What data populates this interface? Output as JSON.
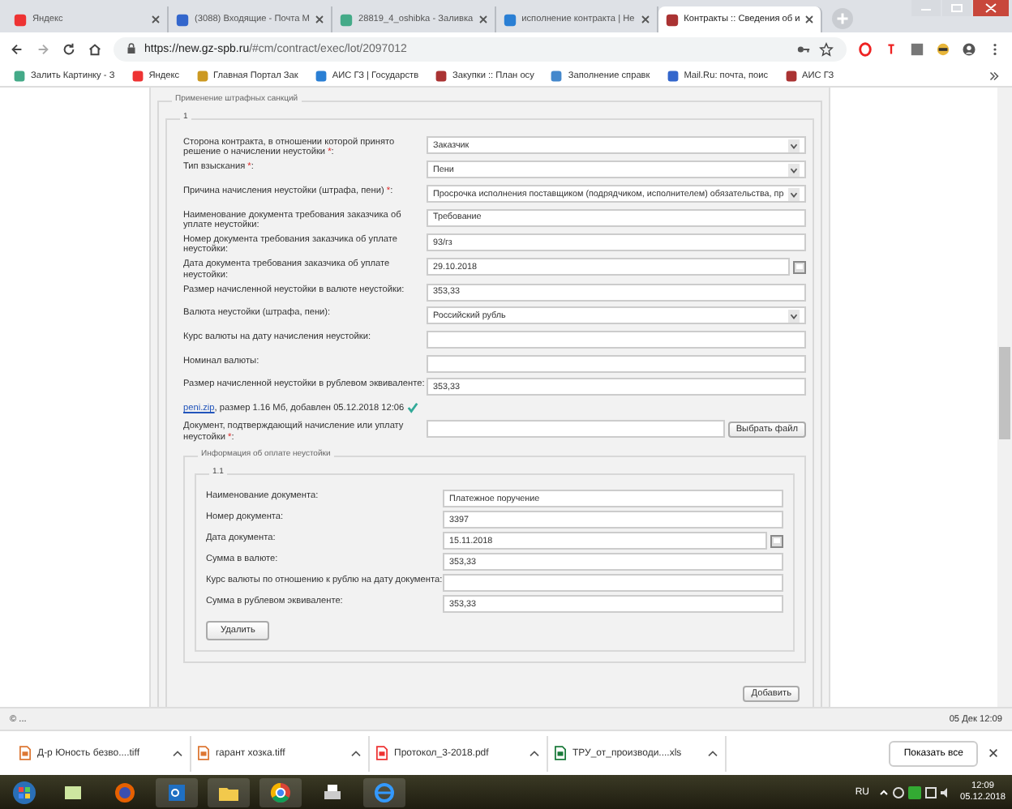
{
  "browser": {
    "tabs": [
      {
        "title": "Яндекс",
        "selected": false
      },
      {
        "title": "(3088) Входящие - Почта М",
        "selected": false
      },
      {
        "title": "28819_4_oshibka - Заливка",
        "selected": false
      },
      {
        "title": "исполнение контракта | Не",
        "selected": false
      },
      {
        "title": "Контракты :: Сведения об и",
        "selected": true
      }
    ],
    "url_host": "https://new.gz-spb.ru",
    "url_path": "/#cm/contract/exec/lot/2097012",
    "bookmarks": [
      {
        "title": "Залить Картинку - З"
      },
      {
        "title": "Яндекс"
      },
      {
        "title": "Главная Портал Зак"
      },
      {
        "title": "АИС ГЗ | Государств"
      },
      {
        "title": "Закупки :: План осу"
      },
      {
        "title": "Заполнение справк"
      },
      {
        "title": "Mail.Ru: почта, поис"
      },
      {
        "title": "АИС ГЗ"
      }
    ]
  },
  "form": {
    "legend": "Применение штрафных санкций",
    "group": "1",
    "fields": [
      {
        "kind": "select",
        "label": "Сторона контракта, в отношении которой принято решение о начислении неустойки ",
        "mark": "*",
        "label_end": ":",
        "value": "Заказчик"
      },
      {
        "kind": "select",
        "label": "Тип взыскания ",
        "mark": "*",
        "label_end": ":",
        "value": "Пени"
      },
      {
        "kind": "select",
        "label": "Причина начисления неустойки (штрафа, пени) ",
        "mark": "*",
        "label_end": ":",
        "value": "Просрочка исполнения поставщиком (подрядчиком, исполнителем) обязательства, пр"
      },
      {
        "kind": "text",
        "label": "Наименование документа требования заказчика об уплате неустойки:",
        "value": "Требование"
      },
      {
        "kind": "text",
        "label": "Номер документа требования заказчика об уплате неустойки:",
        "value": "93/гз"
      },
      {
        "kind": "date",
        "label": "Дата документа требования заказчика об уплате неустойки:",
        "value": "29.10.2018"
      },
      {
        "kind": "text",
        "label": "Размер начисленной неустойки в валюте неустойки:",
        "value": "353,33"
      },
      {
        "kind": "select",
        "label": "Валюта неустойки (штрафа, пени):",
        "value": "Российский рубль"
      },
      {
        "kind": "text",
        "label": "Курс валюты на дату начисления неустойки:"
      },
      {
        "kind": "text",
        "label": "Номинал валюты:"
      },
      {
        "kind": "text",
        "label": "Размер начисленной неустойки в рублевом эквиваленте:",
        "value": "353,33"
      }
    ],
    "attachment": {
      "link": "peni.zip",
      "info": ", размер 1.16 Мб, добавлен 05.12.2018 12:06"
    },
    "document": {
      "label": "Документ, подтверждающий начисление или уплату неустойки ",
      "mark": "*",
      "label_end": ":",
      "button": "Выбрать файл"
    },
    "payment": {
      "legend": "Информация об оплате неустойки",
      "group": "1.1",
      "fields": [
        {
          "kind": "text",
          "label": "Наименование документа:",
          "value": "Платежное поручение"
        },
        {
          "kind": "text",
          "label": "Номер документа:",
          "value": "3397"
        },
        {
          "kind": "date",
          "label": "Дата документа:",
          "value": "15.11.2018"
        },
        {
          "kind": "text",
          "label": "Сумма в валюте:",
          "value": "353,33"
        },
        {
          "kind": "text",
          "label": "Курс валюты по отношению к рублю на дату документа:"
        },
        {
          "kind": "text",
          "label": "Сумма в рублевом эквиваленте:",
          "value": "353,33"
        }
      ],
      "delete_button": "Удалить"
    },
    "add_button": "Добавить"
  },
  "status_bar": {
    "left": "© ...",
    "right": "05 Дек 12:09"
  },
  "downloads": {
    "items": [
      {
        "name": "Д-р Юность безво....tiff",
        "kind": "image"
      },
      {
        "name": "гарант хозка.tiff",
        "kind": "image"
      },
      {
        "name": "Протокол_3-2018.pdf",
        "kind": "pdf"
      },
      {
        "name": "ТРУ_от_производи....xls",
        "kind": "excel"
      }
    ],
    "show_all": "Показать все"
  },
  "taskbar": {
    "language": "RU",
    "time": "12:09",
    "date": "05.12.2018"
  }
}
